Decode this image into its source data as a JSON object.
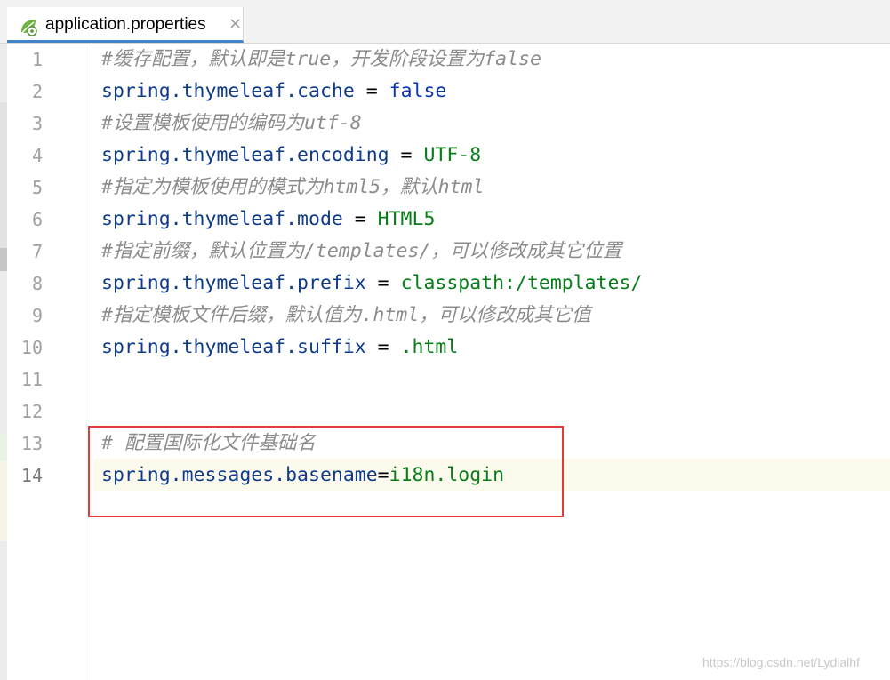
{
  "tab": {
    "label": "application.properties",
    "close": "×",
    "icon": "spring-leaf-icon"
  },
  "lines": [
    {
      "n": "1",
      "comment": "#缓存配置，默认即是true，开发阶段设置为false"
    },
    {
      "n": "2",
      "key": "spring.thymeleaf.cache",
      "eq": " = ",
      "value": "false",
      "value_kind": "keyword"
    },
    {
      "n": "3",
      "comment": "#设置模板使用的编码为utf-8"
    },
    {
      "n": "4",
      "key": "spring.thymeleaf.encoding",
      "eq": " = ",
      "value": "UTF-8"
    },
    {
      "n": "5",
      "comment": "#指定为模板使用的模式为html5，默认html"
    },
    {
      "n": "6",
      "key": "spring.thymeleaf.mode",
      "eq": " = ",
      "value": "HTML5"
    },
    {
      "n": "7",
      "comment": "#指定前缀，默认位置为/templates/，可以修改成其它位置"
    },
    {
      "n": "8",
      "key": "spring.thymeleaf.prefix",
      "eq": " = ",
      "value": "classpath:/templates/"
    },
    {
      "n": "9",
      "comment": "#指定模板文件后缀，默认值为.html，可以修改成其它值"
    },
    {
      "n": "10",
      "key": "spring.thymeleaf.suffix",
      "eq": " = ",
      "value": ".html"
    },
    {
      "n": "11"
    },
    {
      "n": "12"
    },
    {
      "n": "13",
      "comment": "# 配置国际化文件基础名"
    },
    {
      "n": "14",
      "key": "spring.messages.basename",
      "eq": "=",
      "value": "i18n.login",
      "current": true
    }
  ],
  "colors": {
    "key": "#0e3c8a",
    "value": "#067d17",
    "keyword": "#0b36b3",
    "comment": "#8c8c8c",
    "highlight_box": "#e53935",
    "tab_underline": "#4083c9"
  },
  "watermark": "https://blog.csdn.net/Lydialhf"
}
